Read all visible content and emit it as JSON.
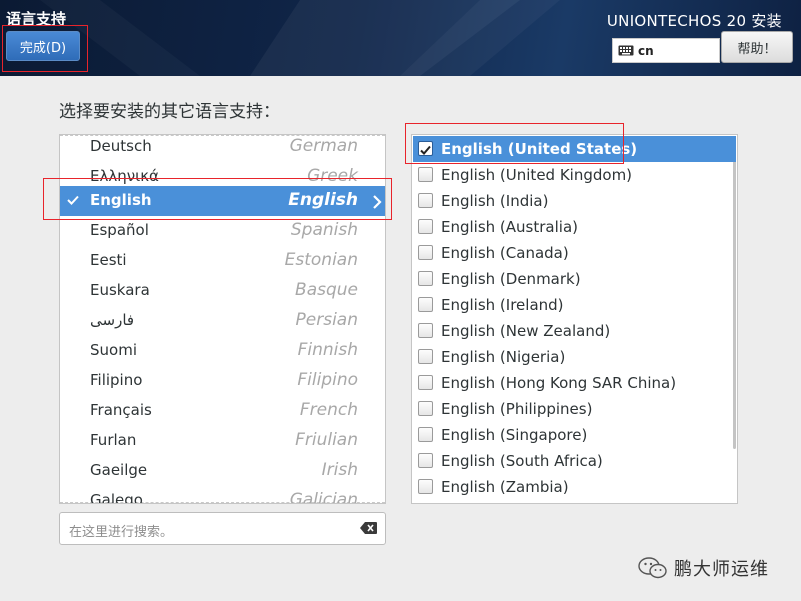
{
  "header": {
    "title": "语言支持",
    "done_label": "完成(D)",
    "product": "UNIONTECHOS 20 安装",
    "keyboard_layout": "cn",
    "help_label": "帮助！"
  },
  "prompt": "选择要安装的其它语言支持：",
  "languages": [
    {
      "native": "Deutsch",
      "english": "German"
    },
    {
      "native": "Ελληνικά",
      "english": "Greek"
    },
    {
      "native": "English",
      "english": "English",
      "selected": true
    },
    {
      "native": "Español",
      "english": "Spanish"
    },
    {
      "native": "Eesti",
      "english": "Estonian"
    },
    {
      "native": "Euskara",
      "english": "Basque"
    },
    {
      "native": "فارسی",
      "english": "Persian"
    },
    {
      "native": "Suomi",
      "english": "Finnish"
    },
    {
      "native": "Filipino",
      "english": "Filipino"
    },
    {
      "native": "Français",
      "english": "French"
    },
    {
      "native": "Furlan",
      "english": "Friulian"
    },
    {
      "native": "Gaeilge",
      "english": "Irish"
    },
    {
      "native": "Galego",
      "english": "Galician"
    }
  ],
  "locales": [
    {
      "label": "English (United States)",
      "checked": true
    },
    {
      "label": "English (United Kingdom)",
      "checked": false
    },
    {
      "label": "English (India)",
      "checked": false
    },
    {
      "label": "English (Australia)",
      "checked": false
    },
    {
      "label": "English (Canada)",
      "checked": false
    },
    {
      "label": "English (Denmark)",
      "checked": false
    },
    {
      "label": "English (Ireland)",
      "checked": false
    },
    {
      "label": "English (New Zealand)",
      "checked": false
    },
    {
      "label": "English (Nigeria)",
      "checked": false
    },
    {
      "label": "English (Hong Kong SAR China)",
      "checked": false
    },
    {
      "label": "English (Philippines)",
      "checked": false
    },
    {
      "label": "English (Singapore)",
      "checked": false
    },
    {
      "label": "English (South Africa)",
      "checked": false
    },
    {
      "label": "English (Zambia)",
      "checked": false
    }
  ],
  "search": {
    "placeholder": "在这里进行搜索。"
  },
  "watermark": "鹏大师运维",
  "colors": {
    "selection": "#4a90d9",
    "header": "#10264a",
    "annotation": "#e8242b"
  }
}
